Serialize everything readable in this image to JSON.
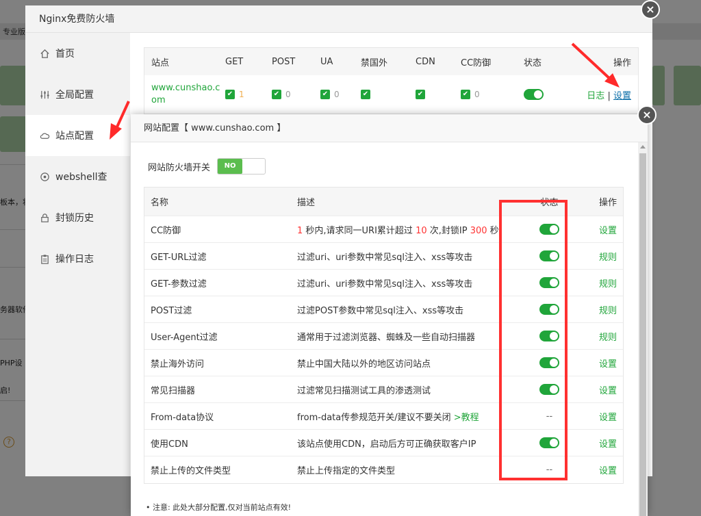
{
  "background": {
    "tag": "专业版",
    "fragments": [
      "板本，将",
      "务器软件",
      "PHP设",
      "启!"
    ],
    "help_icon": "?"
  },
  "outer_modal": {
    "title": "Nginx免费防火墙",
    "sidebar": [
      {
        "label": "首页",
        "icon": "home-icon"
      },
      {
        "label": "全局配置",
        "icon": "sliders-icon"
      },
      {
        "label": "站点配置",
        "icon": "cloud-icon"
      },
      {
        "label": "webshell查",
        "icon": "target-icon"
      },
      {
        "label": "封锁历史",
        "icon": "lock-icon"
      },
      {
        "label": "操作日志",
        "icon": "clipboard-icon"
      }
    ],
    "site_table": {
      "headers": [
        "站点",
        "GET",
        "POST",
        "UA",
        "禁国外",
        "CDN",
        "CC防御",
        "状态",
        "操作"
      ],
      "row": {
        "site_line1": "www.cunshao.c",
        "site_line2": "om",
        "get_count": "1",
        "post_count": "0",
        "ua_count": "0",
        "cc_count": "0",
        "log_label": "日志",
        "separator": "|",
        "settings_label": "设置"
      }
    },
    "close": "×"
  },
  "inner_modal": {
    "title": "网站配置【 www.cunshao.com 】",
    "fw_switch_label": "网站防火墙开关",
    "fw_switch_value": "NO",
    "headers": {
      "name": "名称",
      "desc": "描述",
      "status": "状态",
      "op": "操作"
    },
    "cc": {
      "name": "CC防御",
      "seconds": "1",
      "t1": " 秒内,请求同一URI累计超过 ",
      "count": "10",
      "t2": " 次,封锁IP ",
      "block": "300",
      "t3": " 秒",
      "op": "设置"
    },
    "rules": [
      {
        "name": "GET-URL过滤",
        "desc": "过滤uri、uri参数中常见sql注入、xss等攻击",
        "op": "规则"
      },
      {
        "name": "GET-参数过滤",
        "desc": "过滤uri、uri参数中常见sql注入、xss等攻击",
        "op": "规则"
      },
      {
        "name": "POST过滤",
        "desc": "过滤POST参数中常见sql注入、xss等攻击",
        "op": "规则"
      },
      {
        "name": "User-Agent过滤",
        "desc": "通常用于过滤浏览器、蜘蛛及一些自动扫描器",
        "op": "规则"
      },
      {
        "name": "禁止海外访问",
        "desc": "禁止中国大陆以外的地区访问站点",
        "op": "设置"
      },
      {
        "name": "常见扫描器",
        "desc": "过滤常见扫描测试工具的渗透测试",
        "op": "设置"
      }
    ],
    "fromdata": {
      "name": "From-data协议",
      "desc": "from-data传参规范开关/建议不要关闭 ",
      "link": ">教程",
      "status": "--",
      "op": "设置"
    },
    "cdn": {
      "name": "使用CDN",
      "desc": "该站点使用CDN，启动后方可正确获取客户IP",
      "op": "设置"
    },
    "upload": {
      "name": "禁止上传的文件类型",
      "desc": "禁止上传指定的文件类型",
      "status": "--",
      "op": "设置"
    },
    "note": "•  注意: 此处大部分配置,仅对当前站点有效!",
    "close": "×"
  },
  "colors": {
    "accent": "#20a53a",
    "highlight": "#ff3030"
  }
}
